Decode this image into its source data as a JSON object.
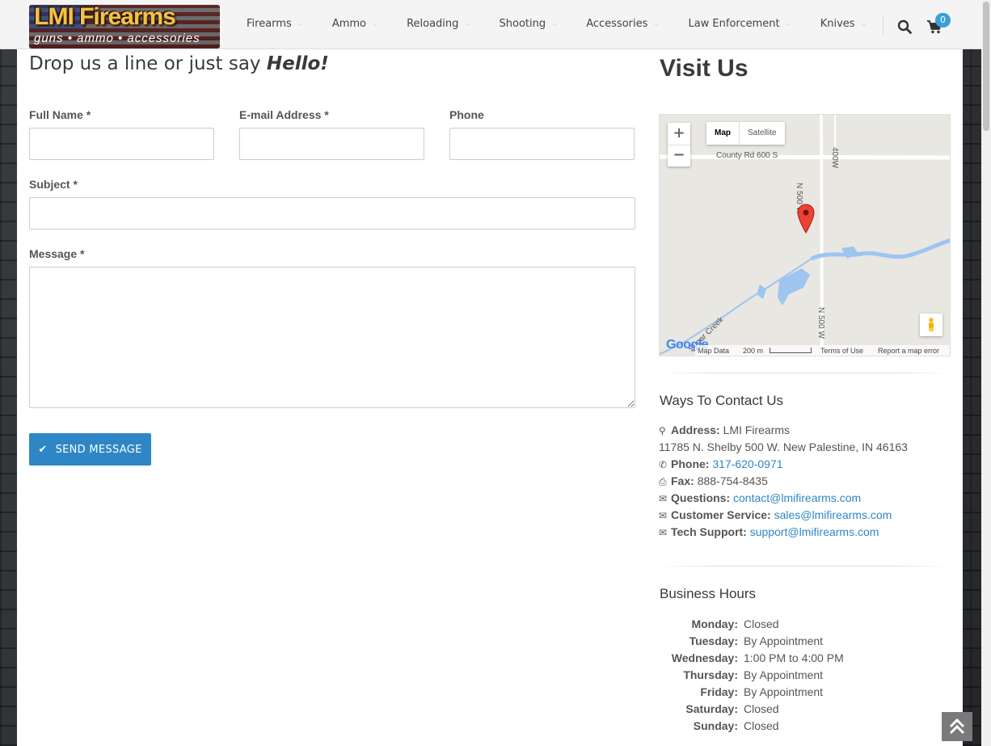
{
  "header": {
    "logo_title": "LMI Firearms",
    "logo_tagline": "guns • ammo • accessories",
    "nav": [
      {
        "label": "Firearms"
      },
      {
        "label": "Ammo"
      },
      {
        "label": "Reloading"
      },
      {
        "label": "Shooting"
      },
      {
        "label": "Accessories"
      },
      {
        "label": "Law Enforcement"
      },
      {
        "label": "Knives"
      }
    ],
    "cart_count": "0",
    "icons": {
      "search": "search-icon",
      "cart": "shopping-cart-icon",
      "chevron": "chevron-down-icon"
    }
  },
  "form": {
    "heading_prefix": "Drop us a line or just say ",
    "heading_emphasis": "Hello!",
    "full_name_label": "Full Name *",
    "email_label": "E-mail Address *",
    "phone_label": "Phone",
    "subject_label": "Subject *",
    "message_label": "Message *",
    "full_name_value": "",
    "email_value": "",
    "phone_value": "",
    "subject_value": "",
    "message_value": "",
    "send_label": "SEND MESSAGE"
  },
  "visit": {
    "heading": "Visit Us",
    "map": {
      "type_map": "Map",
      "type_satellite": "Satellite",
      "zoom_in": "+",
      "zoom_out": "−",
      "road_label_1": "County Rd 600 S",
      "road_label_2": "N 500 W",
      "road_label_3": "N 500 W",
      "road_label_4": "400W",
      "creek_label": "Sugar Creek",
      "google": "Google",
      "map_data": "Map Data",
      "scale": "200 m",
      "terms": "Terms of Use",
      "report": "Report a map error"
    }
  },
  "contact": {
    "heading": "Ways To Contact Us",
    "address_label": "Address:",
    "address_name": "LMI Firearms",
    "address_line": "11785 N. Shelby 500 W. New Palestine, IN 46163",
    "phone_label": "Phone:",
    "phone_value": "317-620-0971",
    "fax_label": "Fax:",
    "fax_value": "888-754-8435",
    "questions_label": "Questions:",
    "questions_value": "contact@lmifirearms.com",
    "service_label": "Customer Service:",
    "service_value": "sales@lmifirearms.com",
    "tech_label": "Tech Support:",
    "tech_value": "support@lmifirearms.com"
  },
  "hours": {
    "heading": "Business Hours",
    "days": [
      {
        "day": "Monday:",
        "value": "Closed"
      },
      {
        "day": "Tuesday:",
        "value": "By Appointment"
      },
      {
        "day": "Wednesday:",
        "value": "1:00 PM to 4:00 PM"
      },
      {
        "day": "Thursday:",
        "value": "By Appointment"
      },
      {
        "day": "Friday:",
        "value": "By Appointment"
      },
      {
        "day": "Saturday:",
        "value": "Closed"
      },
      {
        "day": "Sunday:",
        "value": "Closed"
      }
    ]
  },
  "colors": {
    "accent": "#2f86c6",
    "badge": "#3aa0d8"
  }
}
